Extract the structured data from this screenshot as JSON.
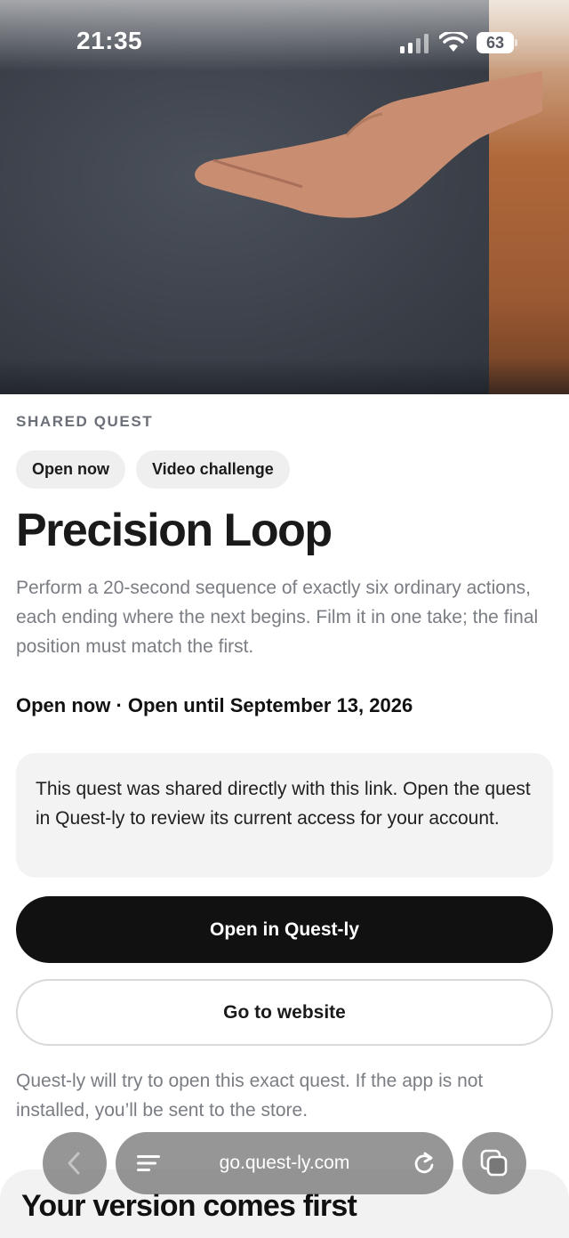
{
  "status_bar": {
    "time": "21:35",
    "battery": "63"
  },
  "quest": {
    "eyebrow": "SHARED QUEST",
    "chips": [
      "Open now",
      "Video challenge"
    ],
    "title": "Precision Loop",
    "description": "Perform a 20-second sequence of exactly six ordinary actions, each ending where the next begins. Film it in one take; the final position must match the first.",
    "availability": "Open now · Open until September 13, 2026",
    "notice": "This quest was shared directly with this link. Open the quest in Quest-ly to review its current access for your account.",
    "primary_button": "Open in Quest-ly",
    "secondary_button": "Go to website",
    "note": "Quest-ly will try to open this exact quest. If the app is not installed, you’ll be sent to the store."
  },
  "bottom_section": {
    "title": "Your version comes first"
  },
  "browser": {
    "url": "go.quest-ly.com",
    "icons": [
      "back-icon",
      "menu-icon",
      "reload-icon",
      "tabs-icon"
    ]
  },
  "colors": {
    "primary_button_bg": "#111111",
    "chip_bg": "#efefef",
    "muted_text": "#7a7d83"
  }
}
